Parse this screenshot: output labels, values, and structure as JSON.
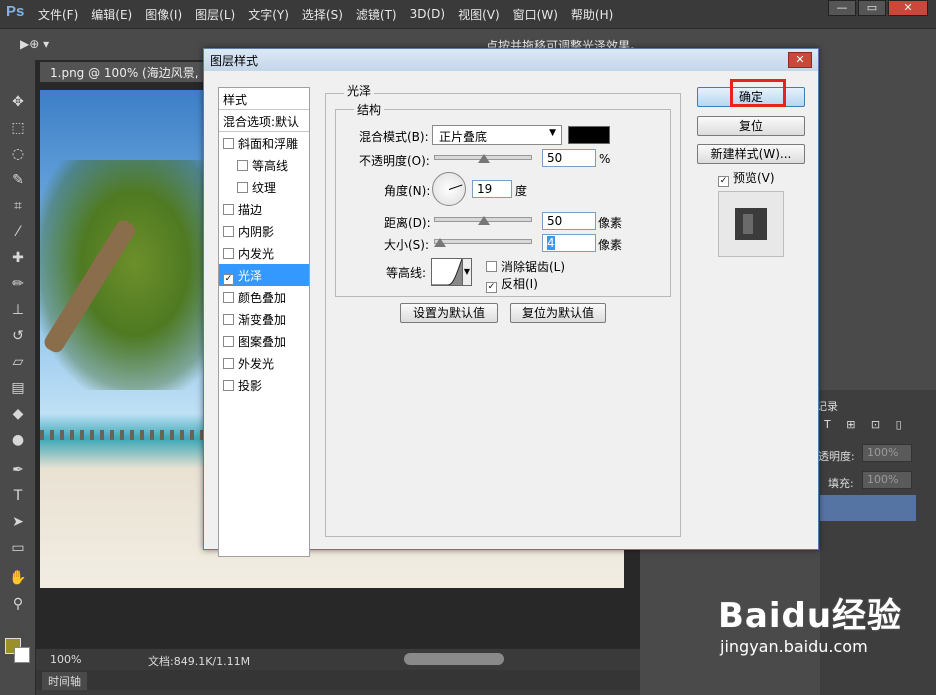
{
  "app": {
    "logo": "Ps"
  },
  "menu": [
    "文件(F)",
    "编辑(E)",
    "图像(I)",
    "图层(L)",
    "文字(Y)",
    "选择(S)",
    "滤镜(T)",
    "3D(D)",
    "视图(V)",
    "窗口(W)",
    "帮助(H)"
  ],
  "window_controls": {
    "minimize": "—",
    "restore": "▭",
    "close": "✕"
  },
  "options_bar": {
    "tool": "▶⊕ ▾",
    "hint": "点按并拖移可调整光泽效果。"
  },
  "document": {
    "tab": "1.png @ 100% (海边风景, R",
    "zoom": "100%",
    "doc_info": "文档:849.1K/1.11M"
  },
  "timeline": {
    "label": "时间轴"
  },
  "right_panel": {
    "opacity_label": "透明度:",
    "opacity_value": "100%",
    "fill_label": "填充:",
    "fill_value": "100%",
    "record_label": "记录",
    "lock_icons": "T ⊞ ⊡ ▯"
  },
  "dialog": {
    "title": "图层样式",
    "close": "✕",
    "style_list": {
      "header": "样式",
      "blending": "混合选项:默认",
      "items": [
        {
          "label": "斜面和浮雕",
          "checked": false,
          "indent": false
        },
        {
          "label": "等高线",
          "checked": false,
          "indent": true
        },
        {
          "label": "纹理",
          "checked": false,
          "indent": true
        },
        {
          "label": "描边",
          "checked": false,
          "indent": false
        },
        {
          "label": "内阴影",
          "checked": false,
          "indent": false
        },
        {
          "label": "内发光",
          "checked": false,
          "indent": false
        },
        {
          "label": "光泽",
          "checked": true,
          "indent": false,
          "selected": true
        },
        {
          "label": "颜色叠加",
          "checked": false,
          "indent": false
        },
        {
          "label": "渐变叠加",
          "checked": false,
          "indent": false
        },
        {
          "label": "图案叠加",
          "checked": false,
          "indent": false
        },
        {
          "label": "外发光",
          "checked": false,
          "indent": false
        },
        {
          "label": "投影",
          "checked": false,
          "indent": false
        }
      ]
    },
    "satin": {
      "section_title": "光泽",
      "structure_title": "结构",
      "blend_mode_label": "混合模式(B):",
      "blend_mode_value": "正片叠底",
      "color": "#000000",
      "opacity_label": "不透明度(O):",
      "opacity_value": "50",
      "opacity_unit": "%",
      "angle_label": "角度(N):",
      "angle_value": "19",
      "angle_unit": "度",
      "distance_label": "距离(D):",
      "distance_value": "50",
      "distance_unit": "像素",
      "size_label": "大小(S):",
      "size_value": "4",
      "size_unit": "像素",
      "contour_label": "等高线:",
      "antialias_label": "消除锯齿(L)",
      "antialias_checked": false,
      "invert_label": "反相(I)",
      "invert_checked": true,
      "set_default": "设置为默认值",
      "reset_default": "复位为默认值"
    },
    "buttons": {
      "ok": "确定",
      "reset": "复位",
      "new_style": "新建样式(W)...",
      "preview_label": "预览(V)",
      "preview_checked": true
    }
  },
  "watermark": {
    "logo": "Baidu经验",
    "url": "jingyan.baidu.com"
  }
}
